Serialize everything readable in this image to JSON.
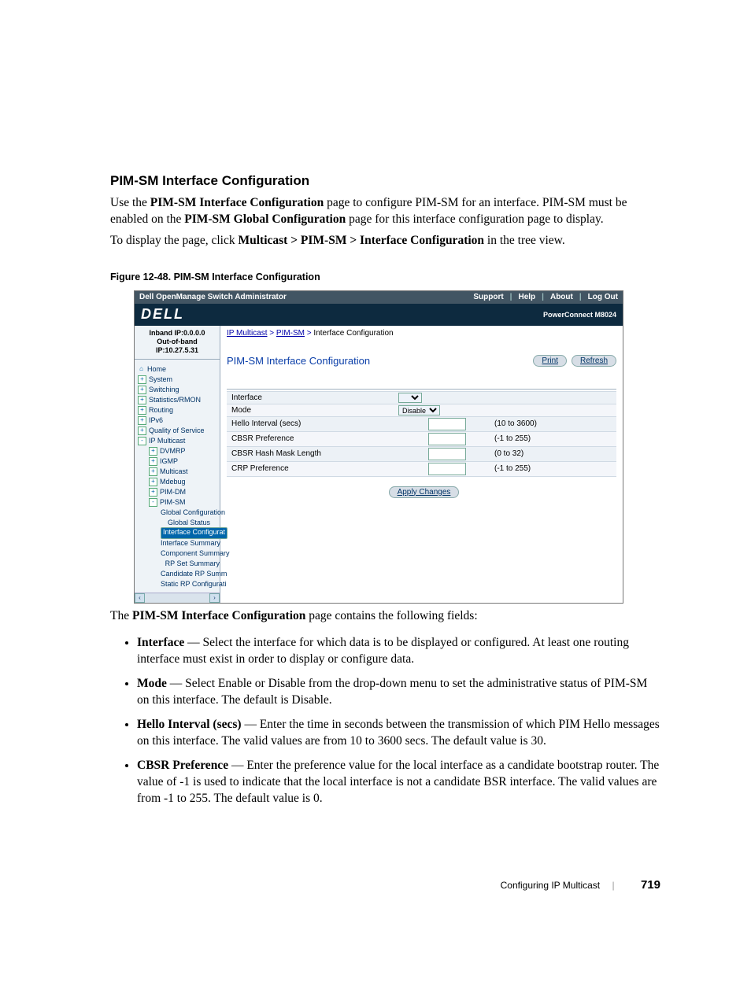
{
  "section_title": "PIM-SM Interface Configuration",
  "intro_sentence_prefix": "Use the ",
  "intro_sentence_bold1": "PIM-SM Interface Configuration",
  "intro_sentence_mid1": " page to configure PIM-SM for an interface. PIM-SM must be enabled on the ",
  "intro_sentence_bold2": "PIM-SM Global Configuration",
  "intro_sentence_end": " page for this interface configuration page to display.",
  "nav_sentence_prefix": "To display the page, click ",
  "nav_sentence_bold": "Multicast > PIM-SM > Interface Configuration",
  "nav_sentence_end": " in the tree view.",
  "figure_caption": "Figure 12-48.    PIM-SM Interface Configuration",
  "titlebar": {
    "app": "Dell OpenManage Switch Administrator",
    "links": [
      "Support",
      "Help",
      "About",
      "Log Out"
    ]
  },
  "brand": {
    "logo": "DELL",
    "model": "PowerConnect M8024"
  },
  "sidebar": {
    "ip1": "Inband IP:0.0.0.0",
    "ip2": "Out-of-band IP:10.27.5.31",
    "tree": [
      {
        "exp": "home",
        "label": "Home"
      },
      {
        "exp": "+",
        "label": "System"
      },
      {
        "exp": "+",
        "label": "Switching"
      },
      {
        "exp": "+",
        "label": "Statistics/RMON"
      },
      {
        "exp": "+",
        "label": "Routing"
      },
      {
        "exp": "+",
        "label": "IPv6"
      },
      {
        "exp": "+",
        "label": "Quality of Service"
      },
      {
        "exp": "-",
        "label": "IP Multicast"
      },
      {
        "exp": "+",
        "label": "DVMRP",
        "indent": 1
      },
      {
        "exp": "+",
        "label": "IGMP",
        "indent": 1
      },
      {
        "exp": "+",
        "label": "Multicast",
        "indent": 1
      },
      {
        "exp": "+",
        "label": "Mdebug",
        "indent": 1
      },
      {
        "exp": "+",
        "label": "PIM-DM",
        "indent": 1
      },
      {
        "exp": "-",
        "label": "PIM-SM",
        "indent": 1
      },
      {
        "exp": "",
        "label": "Global Configuration",
        "indent": 2
      },
      {
        "exp": "",
        "label": "Global Status",
        "indent": 2
      },
      {
        "exp": "",
        "label": "Interface Configurat",
        "indent": 2,
        "selected": true
      },
      {
        "exp": "",
        "label": "Interface Summary",
        "indent": 2
      },
      {
        "exp": "",
        "label": "Component Summary",
        "indent": 2
      },
      {
        "exp": "",
        "label": "RP Set Summary",
        "indent": 2
      },
      {
        "exp": "",
        "label": "Candidate RP Summ",
        "indent": 2
      },
      {
        "exp": "",
        "label": "Static RP Configurati",
        "indent": 2
      }
    ]
  },
  "crumb": {
    "a": "IP Multicast",
    "b": "PIM-SM",
    "c": "Interface Configuration"
  },
  "main_title": "PIM-SM Interface Configuration",
  "buttons": {
    "print": "Print",
    "refresh": "Refresh",
    "apply": "Apply Changes"
  },
  "form": {
    "rows": [
      {
        "label": "Interface",
        "ctl": "select",
        "value": "",
        "range": ""
      },
      {
        "label": "Mode",
        "ctl": "select",
        "value": "Disable",
        "range": ""
      },
      {
        "label": "Hello Interval (secs)",
        "ctl": "text",
        "value": "",
        "range": "(10 to 3600)"
      },
      {
        "label": "CBSR Preference",
        "ctl": "text",
        "value": "",
        "range": "(-1 to 255)"
      },
      {
        "label": "CBSR Hash Mask Length",
        "ctl": "text",
        "value": "",
        "range": "(0 to 32)"
      },
      {
        "label": "CRP Preference",
        "ctl": "text",
        "value": "",
        "range": "(-1 to 255)"
      }
    ]
  },
  "post_fig_sentence_prefix": "The ",
  "post_fig_sentence_bold": "PIM-SM Interface Configuration",
  "post_fig_sentence_end": " page contains the following fields:",
  "fields": [
    {
      "name": "Interface",
      "desc": " — Select the interface for which data is to be displayed or configured. At least one routing interface must exist in order to display or configure data."
    },
    {
      "name": "Mode",
      "desc": " — Select Enable or Disable from the drop-down menu to set the administrative status of PIM-SM on this interface. The default is Disable."
    },
    {
      "name": "Hello Interval (secs)",
      "desc": " — Enter the time in seconds between the transmission of which PIM Hello messages on this interface. The valid values are from 10 to 3600 secs. The default value is 30."
    },
    {
      "name": "CBSR Preference",
      "desc": " — Enter the preference value for the local interface as a candidate bootstrap router. The value of -1 is used to indicate that the local interface is not a candidate BSR interface. The valid values are from -1 to 255. The default value is 0."
    }
  ],
  "footer": {
    "section": "Configuring IP Multicast",
    "page": "719"
  }
}
